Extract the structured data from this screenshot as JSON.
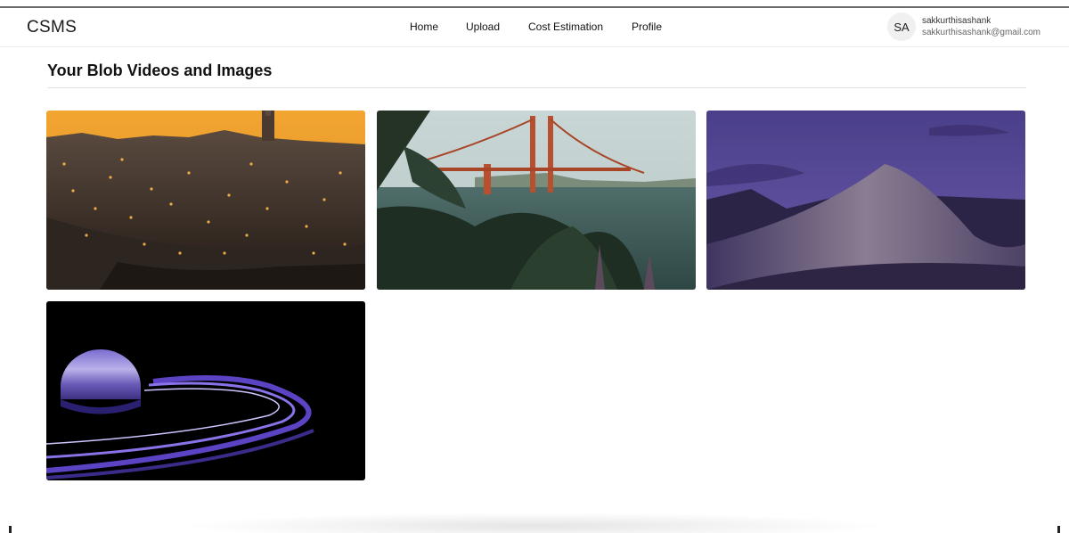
{
  "app": {
    "brand": "CSMS"
  },
  "nav": {
    "items": [
      {
        "label": "Home"
      },
      {
        "label": "Upload"
      },
      {
        "label": "Cost Estimation"
      },
      {
        "label": "Profile"
      }
    ]
  },
  "user": {
    "initials": "SA",
    "username": "sakkurthisashank",
    "email": "sakkurthisashank@gmail.com"
  },
  "main": {
    "title": "Your Blob Videos and Images"
  }
}
